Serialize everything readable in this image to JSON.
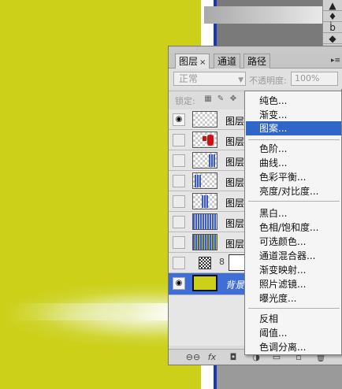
{
  "canvas_color": "#ccd019",
  "highlight_color": "#3166c9",
  "background_toolbar": {
    "tool_glyphs": [
      "▲",
      "♦",
      "ḃ",
      "◆"
    ]
  },
  "panel": {
    "tabs": [
      {
        "label": "图层",
        "close": "×",
        "active": true
      },
      {
        "label": "通道",
        "active": false
      },
      {
        "label": "路径",
        "active": false
      }
    ],
    "menu_glyph": "▸≡",
    "blend_mode": "正常",
    "opacity_label": "不透明度:",
    "opacity_value": "100%",
    "lock_label": "锁定:",
    "layers": [
      {
        "name": "图层",
        "visible": true,
        "thumb": "checker"
      },
      {
        "name": "图层",
        "visible": false,
        "thumb": "red"
      },
      {
        "name": "图层",
        "visible": false,
        "thumb": "blue-right"
      },
      {
        "name": "图层",
        "visible": false,
        "thumb": "blue-left"
      },
      {
        "name": "图层",
        "visible": false,
        "thumb": "blue-center"
      },
      {
        "name": "图层",
        "visible": false,
        "thumb": "blue-grid"
      },
      {
        "name": "图层",
        "visible": false,
        "thumb": "blue-yellow"
      }
    ],
    "adjustment_row": {
      "visible": false,
      "chain": "8"
    },
    "background_layer": {
      "name": "背景",
      "visible": true
    },
    "bottom_icons": [
      "link-icon",
      "fx-icon",
      "mask-icon",
      "adjustment-icon",
      "group-icon",
      "new-layer-icon",
      "delete-icon"
    ],
    "bottom_glyphs": [
      "⊖⊖",
      "fx",
      "◘",
      "◑",
      "▭",
      "▫",
      "🗑"
    ]
  },
  "context_menu": {
    "groups": [
      [
        "纯色...",
        "渐变...",
        "图案..."
      ],
      [
        "色阶...",
        "曲线...",
        "色彩平衡...",
        "亮度/对比度..."
      ],
      [
        "黑白...",
        "色相/饱和度...",
        "可选颜色...",
        "通道混合器...",
        "渐变映射...",
        "照片滤镜...",
        "曝光度..."
      ],
      [
        "反相",
        "阈值...",
        "色调分离..."
      ]
    ],
    "highlighted": "图案..."
  }
}
